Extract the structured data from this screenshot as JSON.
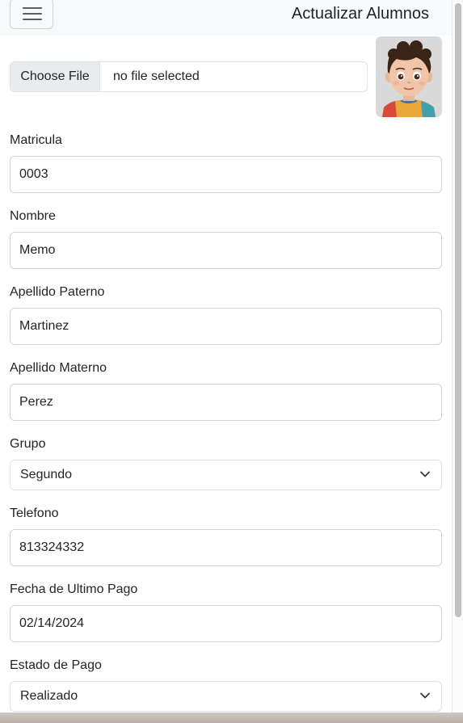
{
  "navbar": {
    "toggle_icon": "hamburger-menu-icon",
    "title": "Actualizar Alumnos"
  },
  "file_input": {
    "button_label": "Choose File",
    "status_text": "no file selected"
  },
  "photo": {
    "description_icon": "student-photo"
  },
  "form": {
    "matricula": {
      "label": "Matricula",
      "value": "0003"
    },
    "nombre": {
      "label": "Nombre",
      "value": "Memo"
    },
    "apellido_paterno": {
      "label": "Apellido Paterno",
      "value": "Martinez"
    },
    "apellido_materno": {
      "label": "Apellido Materno",
      "value": "Perez"
    },
    "grupo": {
      "label": "Grupo",
      "selected": "Segundo"
    },
    "telefono": {
      "label": "Telefono",
      "value": "813324332"
    },
    "fecha_ultimo_pago": {
      "label": "Fecha de Ultimo Pago",
      "value": "02/14/2024"
    },
    "estado_pago": {
      "label": "Estado de Pago",
      "selected": "Realizado"
    }
  },
  "colors": {
    "navbar_bg": "#f8f9fa",
    "border": "#ced4da",
    "text": "#212529",
    "file_button_bg": "#e9ecef"
  }
}
